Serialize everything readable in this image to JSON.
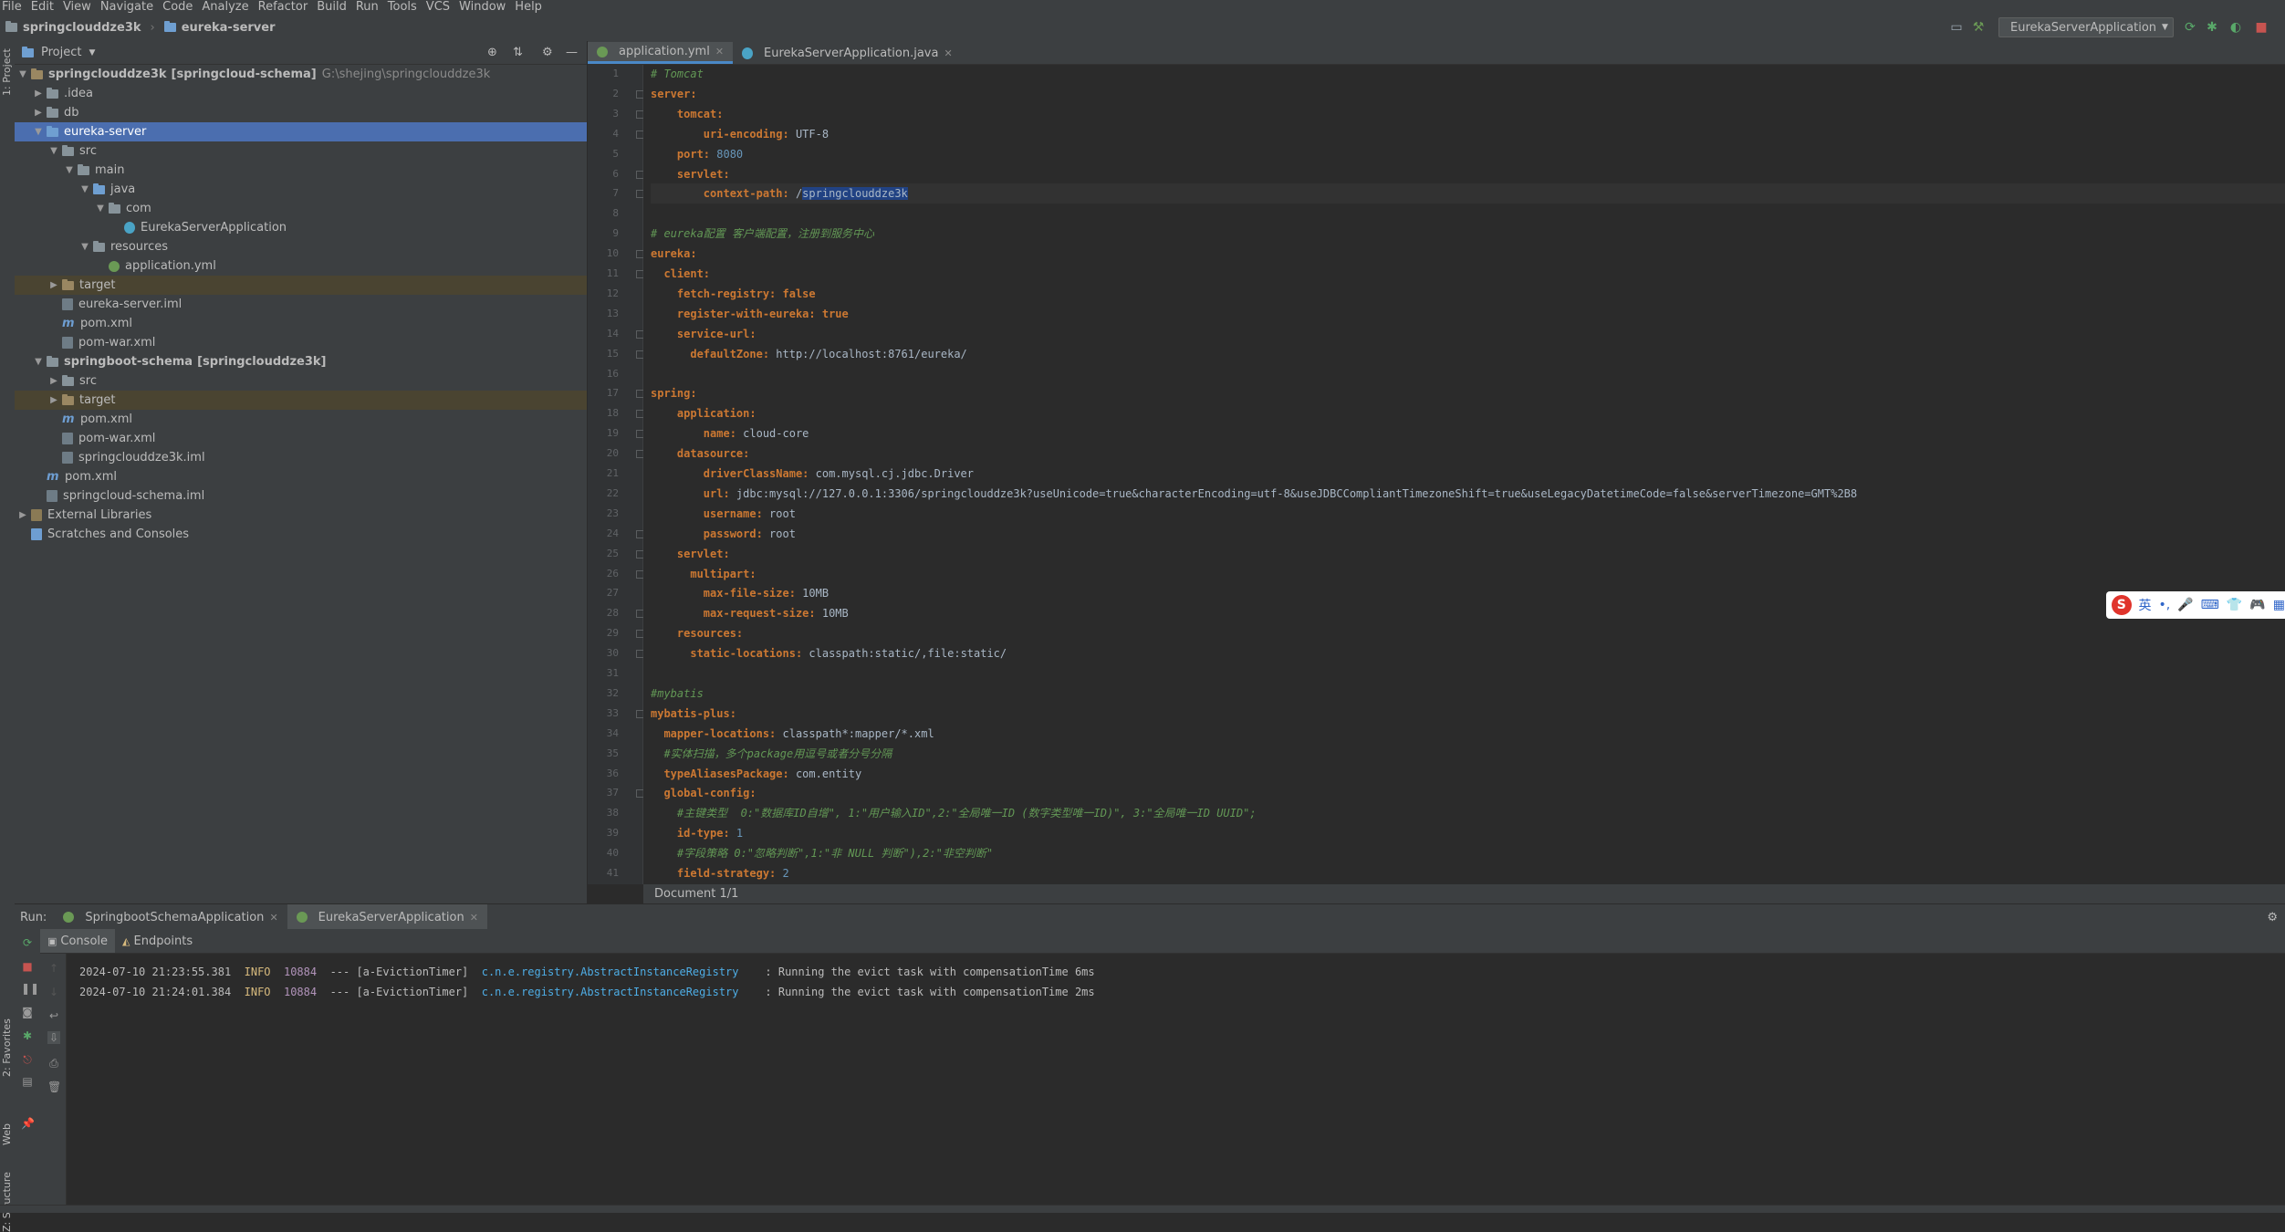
{
  "menu": [
    "File",
    "Edit",
    "View",
    "Navigate",
    "Code",
    "Analyze",
    "Refactor",
    "Build",
    "Run",
    "Tools",
    "VCS",
    "Window",
    "Help"
  ],
  "breadcrumb": {
    "project": "springclouddze3k",
    "module": "eureka-server"
  },
  "run_config": "EurekaServerApplication",
  "left_strip": {
    "project": "1: Project",
    "favorites": "2: Favorites",
    "web": "Web",
    "structure": "Z: Structure"
  },
  "project_panel": {
    "title": "Project"
  },
  "tree": [
    {
      "label": "springclouddze3k",
      "bold_suffix": "[springcloud-schema]",
      "path": "G:\\shejing\\springclouddze3k"
    },
    {
      "label": ".idea"
    },
    {
      "label": "db"
    },
    {
      "label": "eureka-server"
    },
    {
      "label": "src"
    },
    {
      "label": "main"
    },
    {
      "label": "java"
    },
    {
      "label": "com"
    },
    {
      "label": "EurekaServerApplication"
    },
    {
      "label": "resources"
    },
    {
      "label": "application.yml"
    },
    {
      "label": "target"
    },
    {
      "label": "eureka-server.iml"
    },
    {
      "label": "pom.xml"
    },
    {
      "label": "pom-war.xml"
    },
    {
      "label": "springboot-schema",
      "bold_suffix": "[springclouddze3k]"
    },
    {
      "label": "src"
    },
    {
      "label": "target"
    },
    {
      "label": "pom.xml"
    },
    {
      "label": "pom-war.xml"
    },
    {
      "label": "springclouddze3k.iml"
    },
    {
      "label": "pom.xml"
    },
    {
      "label": "springcloud-schema.iml"
    },
    {
      "label": "External Libraries"
    },
    {
      "label": "Scratches and Consoles"
    }
  ],
  "editor_tabs": [
    {
      "label": "application.yml"
    },
    {
      "label": "EurekaServerApplication.java"
    }
  ],
  "code_lines": [
    {
      "n": "1",
      "k": "",
      "v": "",
      "c": "# Tomcat"
    },
    {
      "n": "2",
      "k": "server:",
      "v": "",
      "c": ""
    },
    {
      "n": "3",
      "k": "    tomcat:",
      "v": "",
      "c": ""
    },
    {
      "n": "4",
      "k": "        uri-encoding:",
      "v": " UTF-8",
      "c": ""
    },
    {
      "n": "5",
      "k": "    port:",
      "v": " 8080",
      "c": ""
    },
    {
      "n": "6",
      "k": "    servlet:",
      "v": "",
      "c": ""
    },
    {
      "n": "7",
      "k": "        context-path:",
      "v": " /",
      "sel": "springclouddze3k",
      "c": ""
    },
    {
      "n": "8",
      "k": "",
      "v": "",
      "c": ""
    },
    {
      "n": "9",
      "k": "",
      "v": "",
      "c": "# eureka配置 客户端配置，注册到服务中心"
    },
    {
      "n": "10",
      "k": "eureka:",
      "v": "",
      "c": ""
    },
    {
      "n": "11",
      "k": "  client:",
      "v": "",
      "c": ""
    },
    {
      "n": "12",
      "k": "    fetch-registry:",
      "v": " false",
      "c": ""
    },
    {
      "n": "13",
      "k": "    register-with-eureka:",
      "v": " true",
      "c": ""
    },
    {
      "n": "14",
      "k": "    service-url:",
      "v": "",
      "c": ""
    },
    {
      "n": "15",
      "k": "      defaultZone:",
      "v": " http://localhost:8761/eureka/",
      "c": ""
    },
    {
      "n": "16",
      "k": "",
      "v": "",
      "c": ""
    },
    {
      "n": "17",
      "k": "spring:",
      "v": "",
      "c": ""
    },
    {
      "n": "18",
      "k": "    application:",
      "v": "",
      "c": ""
    },
    {
      "n": "19",
      "k": "        name:",
      "v": " cloud-core",
      "c": ""
    },
    {
      "n": "20",
      "k": "    datasource:",
      "v": "",
      "c": ""
    },
    {
      "n": "21",
      "k": "        driverClassName:",
      "v": " com.mysql.cj.jdbc.Driver",
      "c": ""
    },
    {
      "n": "22",
      "k": "        url:",
      "v": " jdbc:mysql://127.0.0.1:3306/springclouddze3k?useUnicode=true&characterEncoding=utf-8&useJDBCCompliantTimezoneShift=true&useLegacyDatetimeCode=false&serverTimezone=GMT%2B8",
      "c": ""
    },
    {
      "n": "23",
      "k": "        username:",
      "v": " root",
      "c": ""
    },
    {
      "n": "24",
      "k": "        password:",
      "v": " root",
      "c": ""
    },
    {
      "n": "25",
      "k": "    servlet:",
      "v": "",
      "c": ""
    },
    {
      "n": "26",
      "k": "      multipart:",
      "v": "",
      "c": ""
    },
    {
      "n": "27",
      "k": "        max-file-size:",
      "v": " 10MB",
      "c": ""
    },
    {
      "n": "28",
      "k": "        max-request-size:",
      "v": " 10MB",
      "c": ""
    },
    {
      "n": "29",
      "k": "    resources:",
      "v": "",
      "c": ""
    },
    {
      "n": "30",
      "k": "      static-locations:",
      "v": " classpath:static/,file:static/",
      "c": ""
    },
    {
      "n": "31",
      "k": "",
      "v": "",
      "c": ""
    },
    {
      "n": "32",
      "k": "",
      "v": "",
      "c": "#mybatis"
    },
    {
      "n": "33",
      "k": "mybatis-plus:",
      "v": "",
      "c": ""
    },
    {
      "n": "34",
      "k": "  mapper-locations:",
      "v": " classpath*:mapper/*.xml",
      "c": ""
    },
    {
      "n": "35",
      "k": "",
      "v": "",
      "c": "  #实体扫描，多个package用逗号或者分号分隔"
    },
    {
      "n": "36",
      "k": "  typeAliasesPackage:",
      "v": " com.entity",
      "c": ""
    },
    {
      "n": "37",
      "k": "  global-config:",
      "v": "",
      "c": ""
    },
    {
      "n": "38",
      "k": "",
      "v": "",
      "c": "    #主键类型  0:\"数据库ID自增\", 1:\"用户输入ID\",2:\"全局唯一ID (数字类型唯一ID)\", 3:\"全局唯一ID UUID\";"
    },
    {
      "n": "39",
      "k": "    id-type:",
      "v": " 1",
      "c": ""
    },
    {
      "n": "40",
      "k": "",
      "v": "",
      "c": "    #字段策略 0:\"忽略判断\",1:\"非 NULL 判断\"),2:\"非空判断\""
    },
    {
      "n": "41",
      "k": "    field-strategy:",
      "v": " 2",
      "c": ""
    }
  ],
  "doc_status": "Document 1/1",
  "ime": {
    "logo": "S",
    "lang": "英",
    "extra": "•,"
  },
  "run_panel": {
    "label": "Run:",
    "tabs": [
      {
        "label": "SpringbootSchemaApplication"
      },
      {
        "label": "EurekaServerApplication"
      }
    ],
    "sub_tabs": [
      {
        "label": "Console"
      },
      {
        "label": "Endpoints"
      }
    ]
  },
  "console_lines": [
    {
      "ts": "2024-07-10 21:23:55.381",
      "level": "INFO",
      "pid": "10884",
      "thread": "--- [a-EvictionTimer]",
      "cls": "c.n.e.registry.AbstractInstanceRegistry",
      "msg": "  : Running the evict task with compensationTime 6ms"
    },
    {
      "ts": "2024-07-10 21:24:01.384",
      "level": "INFO",
      "pid": "10884",
      "thread": "--- [a-EvictionTimer]",
      "cls": "c.n.e.registry.AbstractInstanceRegistry",
      "msg": "  : Running the evict task with compensationTime 2ms"
    }
  ]
}
